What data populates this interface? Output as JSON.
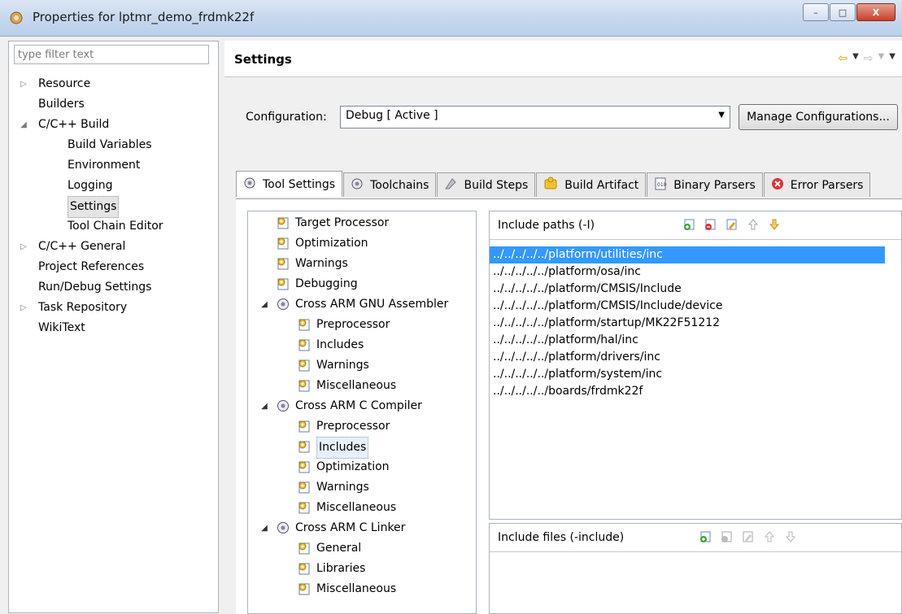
{
  "window": {
    "title": "Properties for lptmr_demo_frdmk22f",
    "minimize": "–",
    "maximize": "□",
    "close": "X"
  },
  "left_nav": {
    "filter_placeholder": "type filter text",
    "items": [
      {
        "label": "Resource",
        "twisty": "▷",
        "indent": 0
      },
      {
        "label": "Builders",
        "twisty": "",
        "indent": 0
      },
      {
        "label": "C/C++ Build",
        "twisty": "◢",
        "indent": 0
      },
      {
        "label": "Build Variables",
        "twisty": "",
        "indent": 1
      },
      {
        "label": "Environment",
        "twisty": "",
        "indent": 1
      },
      {
        "label": "Logging",
        "twisty": "",
        "indent": 1
      },
      {
        "label": "Settings",
        "twisty": "",
        "indent": 1,
        "selected": true
      },
      {
        "label": "Tool Chain Editor",
        "twisty": "",
        "indent": 1
      },
      {
        "label": "C/C++ General",
        "twisty": "▷",
        "indent": 0
      },
      {
        "label": "Project References",
        "twisty": "",
        "indent": 0
      },
      {
        "label": "Run/Debug Settings",
        "twisty": "",
        "indent": 0
      },
      {
        "label": "Task Repository",
        "twisty": "▷",
        "indent": 0
      },
      {
        "label": "WikiText",
        "twisty": "",
        "indent": 0
      }
    ]
  },
  "settings": {
    "title": "Settings",
    "configuration_label": "Configuration:",
    "configuration_value": "Debug  [ Active ]",
    "manage_button": "Manage Configurations..."
  },
  "tabs": [
    {
      "label": "Tool Settings",
      "icon": "gear-icon",
      "active": true
    },
    {
      "label": "Toolchains",
      "icon": "gear-icon"
    },
    {
      "label": "Build Steps",
      "icon": "build-steps-icon"
    },
    {
      "label": "Build Artifact",
      "icon": "artifact-icon"
    },
    {
      "label": "Binary Parsers",
      "icon": "binary-icon"
    },
    {
      "label": "Error Parsers",
      "icon": "error-icon"
    }
  ],
  "tool_tree": [
    {
      "label": "Target Processor",
      "indent": 0,
      "twisty": "",
      "icon": "settings-page-icon"
    },
    {
      "label": "Optimization",
      "indent": 0,
      "twisty": "",
      "icon": "settings-page-icon"
    },
    {
      "label": "Warnings",
      "indent": 0,
      "twisty": "",
      "icon": "settings-page-icon"
    },
    {
      "label": "Debugging",
      "indent": 0,
      "twisty": "",
      "icon": "settings-page-icon"
    },
    {
      "label": "Cross ARM GNU Assembler",
      "indent": 0,
      "twisty": "◢",
      "icon": "gear-icon"
    },
    {
      "label": "Preprocessor",
      "indent": 1,
      "twisty": "",
      "icon": "settings-page-icon"
    },
    {
      "label": "Includes",
      "indent": 1,
      "twisty": "",
      "icon": "settings-page-icon"
    },
    {
      "label": "Warnings",
      "indent": 1,
      "twisty": "",
      "icon": "settings-page-icon"
    },
    {
      "label": "Miscellaneous",
      "indent": 1,
      "twisty": "",
      "icon": "settings-page-icon"
    },
    {
      "label": "Cross ARM C Compiler",
      "indent": 0,
      "twisty": "◢",
      "icon": "gear-icon"
    },
    {
      "label": "Preprocessor",
      "indent": 1,
      "twisty": "",
      "icon": "settings-page-icon"
    },
    {
      "label": "Includes",
      "indent": 1,
      "twisty": "",
      "icon": "settings-page-icon",
      "selected": true
    },
    {
      "label": "Optimization",
      "indent": 1,
      "twisty": "",
      "icon": "settings-page-icon"
    },
    {
      "label": "Warnings",
      "indent": 1,
      "twisty": "",
      "icon": "settings-page-icon"
    },
    {
      "label": "Miscellaneous",
      "indent": 1,
      "twisty": "",
      "icon": "settings-page-icon"
    },
    {
      "label": "Cross ARM C Linker",
      "indent": 0,
      "twisty": "◢",
      "icon": "gear-icon"
    },
    {
      "label": "General",
      "indent": 1,
      "twisty": "",
      "icon": "settings-page-icon"
    },
    {
      "label": "Libraries",
      "indent": 1,
      "twisty": "",
      "icon": "settings-page-icon"
    },
    {
      "label": "Miscellaneous",
      "indent": 1,
      "twisty": "",
      "icon": "settings-page-icon"
    }
  ],
  "include_paths": {
    "title": "Include paths (-I)",
    "items": [
      "../../../../../platform/utilities/inc",
      "../../../../../platform/osa/inc",
      "../../../../../platform/CMSIS/Include",
      "../../../../../platform/CMSIS/Include/device",
      "../../../../../platform/startup/MK22F51212",
      "../../../../../platform/hal/inc",
      "../../../../../platform/drivers/inc",
      "../../../../../platform/system/inc",
      "../../../../../boards/frdmk22f"
    ],
    "selected_index": 0
  },
  "include_files": {
    "title": "Include files (-include)",
    "items": []
  },
  "colors": {
    "selection": "#3399ff",
    "accent_yellow": "#c9a200"
  }
}
